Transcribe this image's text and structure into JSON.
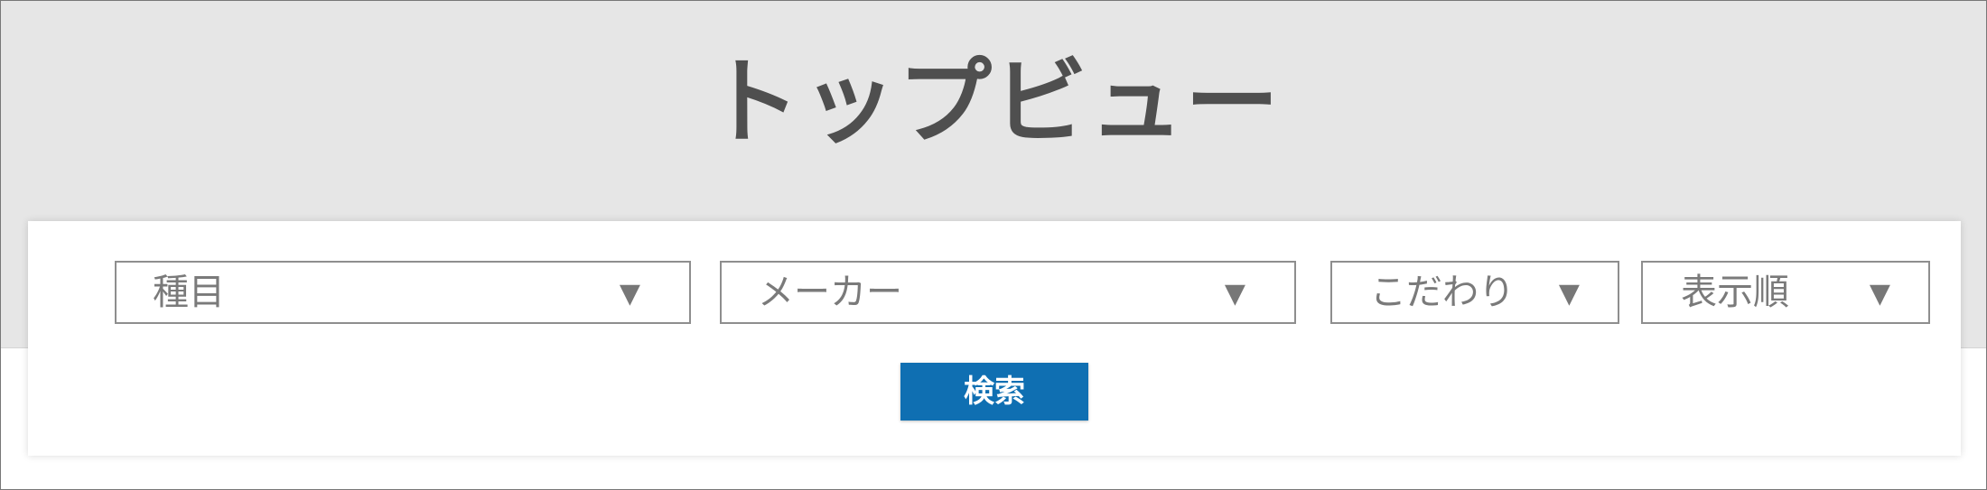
{
  "header": {
    "title": "トップビュー"
  },
  "filters": {
    "category": {
      "label": "種目",
      "arrow": "▼"
    },
    "maker": {
      "label": "メーカー",
      "arrow": "▼"
    },
    "feature": {
      "label": "こだわり",
      "arrow": "▼"
    },
    "order": {
      "label": "表示順",
      "arrow": "▼"
    }
  },
  "actions": {
    "search_label": "検索"
  },
  "colors": {
    "header_background": "#e6e6e6",
    "title_text": "#4f4f4f",
    "button_background": "#0f6fb2",
    "button_text": "#ffffff",
    "select_border": "#8e8e8e",
    "select_text": "#7a7a7a"
  }
}
